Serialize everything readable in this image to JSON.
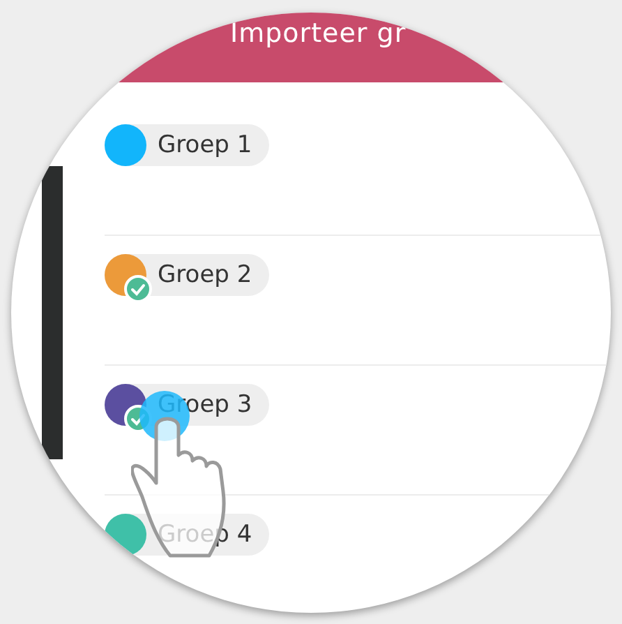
{
  "header": {
    "title": "Importeer gr"
  },
  "groups": [
    {
      "label": "Groep 1",
      "color": "#12b5fb",
      "checked": false
    },
    {
      "label": "Groep 2",
      "color": "#ec9a3a",
      "checked": true
    },
    {
      "label": "Groep 3",
      "color": "#5b4fa0",
      "checked": true
    },
    {
      "label": "Groep 4",
      "color": "#3fc0a8",
      "checked": false
    }
  ]
}
